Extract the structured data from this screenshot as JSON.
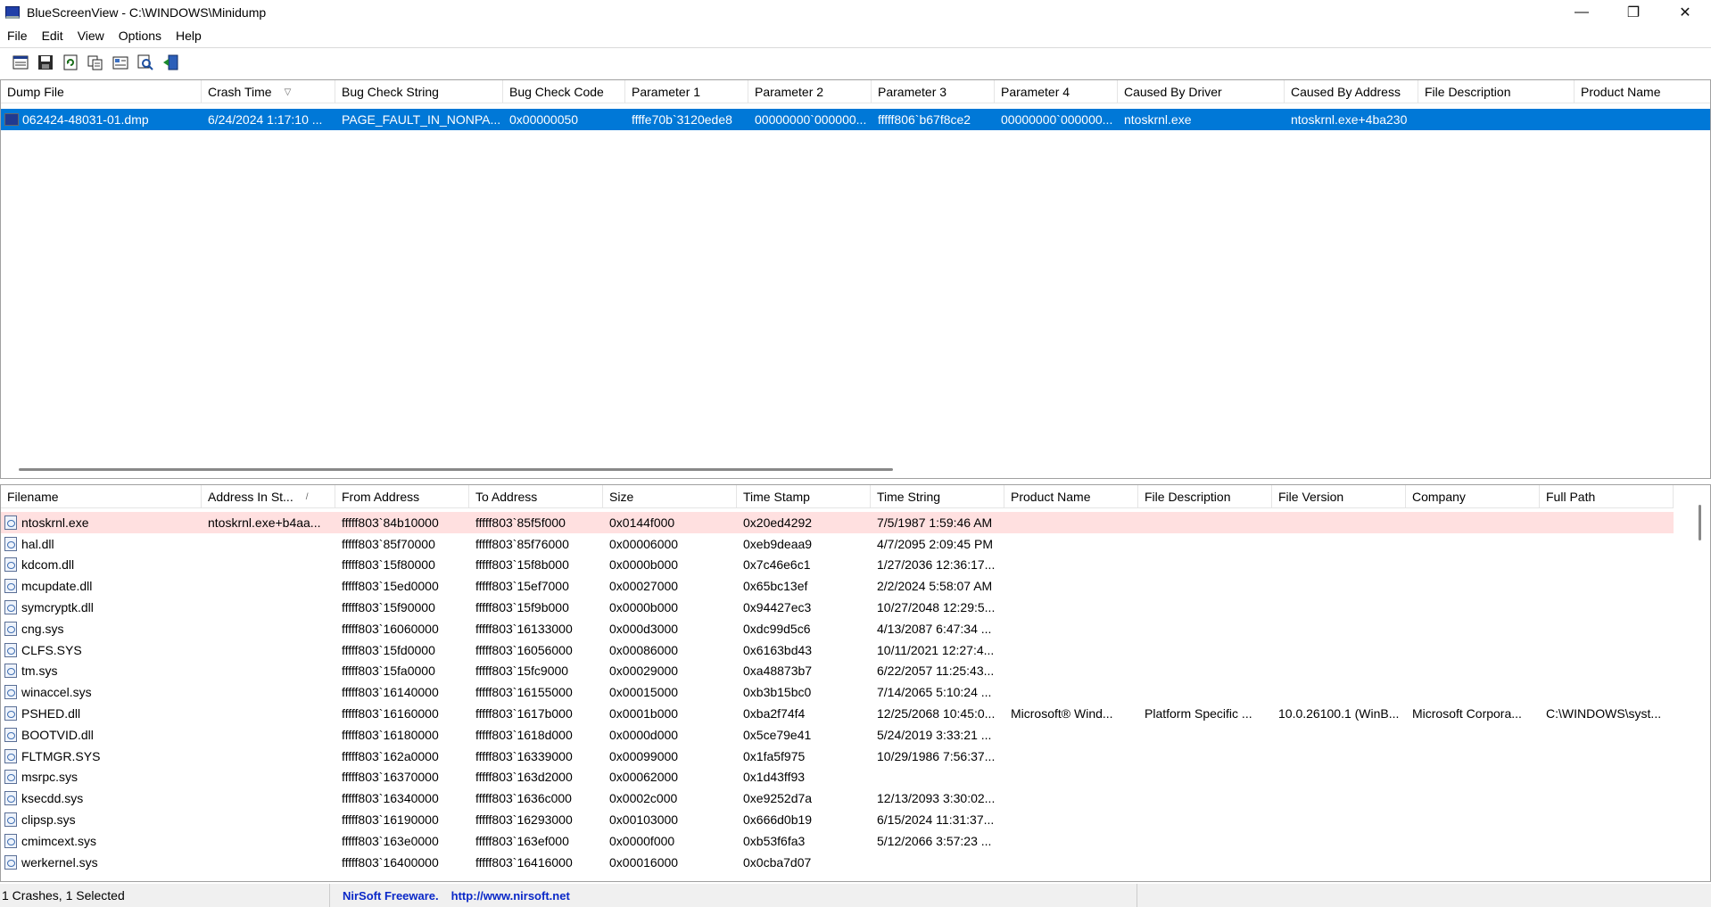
{
  "window": {
    "title": "BlueScreenView  -  C:\\WINDOWS\\Minidump",
    "minimize": "—",
    "restore": "❐",
    "close": "✕"
  },
  "menu": [
    "File",
    "Edit",
    "View",
    "Options",
    "Help"
  ],
  "toolbar": [
    {
      "icon": "properties-window-icon"
    },
    {
      "icon": "save-icon"
    },
    {
      "icon": "refresh-icon"
    },
    {
      "icon": "copy-icon"
    },
    {
      "icon": "properties-icon"
    },
    {
      "icon": "find-icon"
    },
    {
      "icon": "exit-icon"
    }
  ],
  "crash_table": {
    "columns": [
      {
        "label": "Dump File",
        "width": 225
      },
      {
        "label": "Crash Time",
        "width": 150,
        "sort": "▽"
      },
      {
        "label": "Bug Check String",
        "width": 188
      },
      {
        "label": "Bug Check Code",
        "width": 137
      },
      {
        "label": "Parameter 1",
        "width": 138
      },
      {
        "label": "Parameter 2",
        "width": 138
      },
      {
        "label": "Parameter 3",
        "width": 138
      },
      {
        "label": "Parameter 4",
        "width": 138
      },
      {
        "label": "Caused By Driver",
        "width": 187
      },
      {
        "label": "Caused By Address",
        "width": 150
      },
      {
        "label": "File Description",
        "width": 175
      },
      {
        "label": "Product Name",
        "width": 154
      }
    ],
    "rows": [
      [
        "062424-48031-01.dmp",
        "6/24/2024 1:17:10 ...",
        "PAGE_FAULT_IN_NONPA...",
        "0x00000050",
        "ffffe70b`3120ede8",
        "00000000`000000...",
        "fffff806`b67f8ce2",
        "00000000`000000...",
        "ntoskrnl.exe",
        "ntoskrnl.exe+4ba230",
        "",
        ""
      ]
    ]
  },
  "module_table": {
    "columns": [
      {
        "label": "Filename",
        "width": 225
      },
      {
        "label": "Address In St...",
        "width": 150,
        "sort": "/"
      },
      {
        "label": "From Address",
        "width": 150
      },
      {
        "label": "To Address",
        "width": 150
      },
      {
        "label": "Size",
        "width": 150
      },
      {
        "label": "Time Stamp",
        "width": 150
      },
      {
        "label": "Time String",
        "width": 150
      },
      {
        "label": "Product Name",
        "width": 150
      },
      {
        "label": "File Description",
        "width": 150
      },
      {
        "label": "File Version",
        "width": 150
      },
      {
        "label": "Company",
        "width": 150
      },
      {
        "label": "Full Path",
        "width": 150
      }
    ],
    "rows": [
      [
        "ntoskrnl.exe",
        "ntoskrnl.exe+b4aa...",
        "fffff803`84b10000",
        "fffff803`85f5f000",
        "0x0144f000",
        "0x20ed4292",
        "7/5/1987 1:59:46 AM",
        "",
        "",
        "",
        "",
        ""
      ],
      [
        "hal.dll",
        "",
        "fffff803`85f70000",
        "fffff803`85f76000",
        "0x00006000",
        "0xeb9deaa9",
        "4/7/2095 2:09:45 PM",
        "",
        "",
        "",
        "",
        ""
      ],
      [
        "kdcom.dll",
        "",
        "fffff803`15f80000",
        "fffff803`15f8b000",
        "0x0000b000",
        "0x7c46e6c1",
        "1/27/2036 12:36:17...",
        "",
        "",
        "",
        "",
        ""
      ],
      [
        "mcupdate.dll",
        "",
        "fffff803`15ed0000",
        "fffff803`15ef7000",
        "0x00027000",
        "0x65bc13ef",
        "2/2/2024 5:58:07 AM",
        "",
        "",
        "",
        "",
        ""
      ],
      [
        "symcryptk.dll",
        "",
        "fffff803`15f90000",
        "fffff803`15f9b000",
        "0x0000b000",
        "0x94427ec3",
        "10/27/2048 12:29:5...",
        "",
        "",
        "",
        "",
        ""
      ],
      [
        "cng.sys",
        "",
        "fffff803`16060000",
        "fffff803`16133000",
        "0x000d3000",
        "0xdc99d5c6",
        "4/13/2087 6:47:34 ...",
        "",
        "",
        "",
        "",
        ""
      ],
      [
        "CLFS.SYS",
        "",
        "fffff803`15fd0000",
        "fffff803`16056000",
        "0x00086000",
        "0x6163bd43",
        "10/11/2021 12:27:4...",
        "",
        "",
        "",
        "",
        ""
      ],
      [
        "tm.sys",
        "",
        "fffff803`15fa0000",
        "fffff803`15fc9000",
        "0x00029000",
        "0xa48873b7",
        "6/22/2057 11:25:43...",
        "",
        "",
        "",
        "",
        ""
      ],
      [
        "winaccel.sys",
        "",
        "fffff803`16140000",
        "fffff803`16155000",
        "0x00015000",
        "0xb3b15bc0",
        "7/14/2065 5:10:24 ...",
        "",
        "",
        "",
        "",
        ""
      ],
      [
        "PSHED.dll",
        "",
        "fffff803`16160000",
        "fffff803`1617b000",
        "0x0001b000",
        "0xba2f74f4",
        "12/25/2068 10:45:0...",
        "Microsoft® Wind...",
        "Platform Specific ...",
        "10.0.26100.1 (WinB...",
        "Microsoft Corpora...",
        "C:\\WINDOWS\\syst..."
      ],
      [
        "BOOTVID.dll",
        "",
        "fffff803`16180000",
        "fffff803`1618d000",
        "0x0000d000",
        "0x5ce79e41",
        "5/24/2019 3:33:21 ...",
        "",
        "",
        "",
        "",
        ""
      ],
      [
        "FLTMGR.SYS",
        "",
        "fffff803`162a0000",
        "fffff803`16339000",
        "0x00099000",
        "0x1fa5f975",
        "10/29/1986 7:56:37...",
        "",
        "",
        "",
        "",
        ""
      ],
      [
        "msrpc.sys",
        "",
        "fffff803`16370000",
        "fffff803`163d2000",
        "0x00062000",
        "0x1d43ff93",
        "",
        "",
        "",
        "",
        "",
        ""
      ],
      [
        "ksecdd.sys",
        "",
        "fffff803`16340000",
        "fffff803`1636c000",
        "0x0002c000",
        "0xe9252d7a",
        "12/13/2093 3:30:02...",
        "",
        "",
        "",
        "",
        ""
      ],
      [
        "clipsp.sys",
        "",
        "fffff803`16190000",
        "fffff803`16293000",
        "0x00103000",
        "0x666d0b19",
        "6/15/2024 11:31:37...",
        "",
        "",
        "",
        "",
        ""
      ],
      [
        "cmimcext.sys",
        "",
        "fffff803`163e0000",
        "fffff803`163ef000",
        "0x0000f000",
        "0xb53f6fa3",
        "5/12/2066 3:57:23 ...",
        "",
        "",
        "",
        "",
        ""
      ],
      [
        "werkernel.sys",
        "",
        "fffff803`16400000",
        "fffff803`16416000",
        "0x00016000",
        "0x0cba7d07",
        "",
        "",
        "",
        "",
        "",
        ""
      ]
    ]
  },
  "status": {
    "left": "1 Crashes, 1 Selected",
    "freeware": "NirSoft Freeware.",
    "url": "http://www.nirsoft.net"
  }
}
